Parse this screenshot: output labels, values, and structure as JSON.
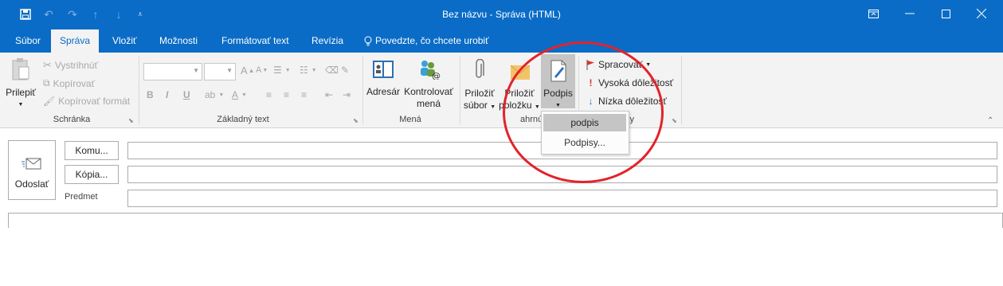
{
  "window": {
    "title": "Bez názvu  -  Správa (HTML)"
  },
  "tabs": [
    "Súbor",
    "Správa",
    "Vložiť",
    "Možnosti",
    "Formátovať text",
    "Revízia",
    "Povedzte, čo chcete urobiť"
  ],
  "ribbon": {
    "clipboard": {
      "paste": "Prilepiť",
      "cut": "Vystrihnúť",
      "copy": "Kopírovať",
      "format_painter": "Kopírovať formát",
      "group_label": "Schránka"
    },
    "basic_text": {
      "bold": "B",
      "italic": "I",
      "underline": "U",
      "grow_font": "A",
      "shrink_font": "A",
      "group_label": "Základný text"
    },
    "names": {
      "address_book": "Adresár",
      "check_names_line1": "Kontrolovať",
      "check_names_line2": "mená",
      "group_label": "Mená"
    },
    "include": {
      "attach_file_line1": "Priložiť",
      "attach_file_line2": "súbor",
      "attach_item_line1": "Priložiť",
      "attach_item_line2": "položku",
      "signature": "Podpis",
      "group_label_visible": "ahrnúť"
    },
    "tags": {
      "follow_up": "Spracovať",
      "high_importance": "Vysoká dôležitosť",
      "low_importance": "Nízka dôležitosť",
      "group_label_visible": "ky"
    }
  },
  "compose": {
    "send": "Odoslať",
    "to": "Komu...",
    "cc": "Kópia...",
    "subject": "Predmet",
    "to_value": "",
    "cc_value": "",
    "subject_value": ""
  },
  "signature_menu": {
    "items": [
      "podpis",
      "Podpisy..."
    ],
    "selected": "podpis"
  },
  "colors": {
    "titlebar": "#0a6cc6",
    "annotation_circle": "#e3232b"
  }
}
